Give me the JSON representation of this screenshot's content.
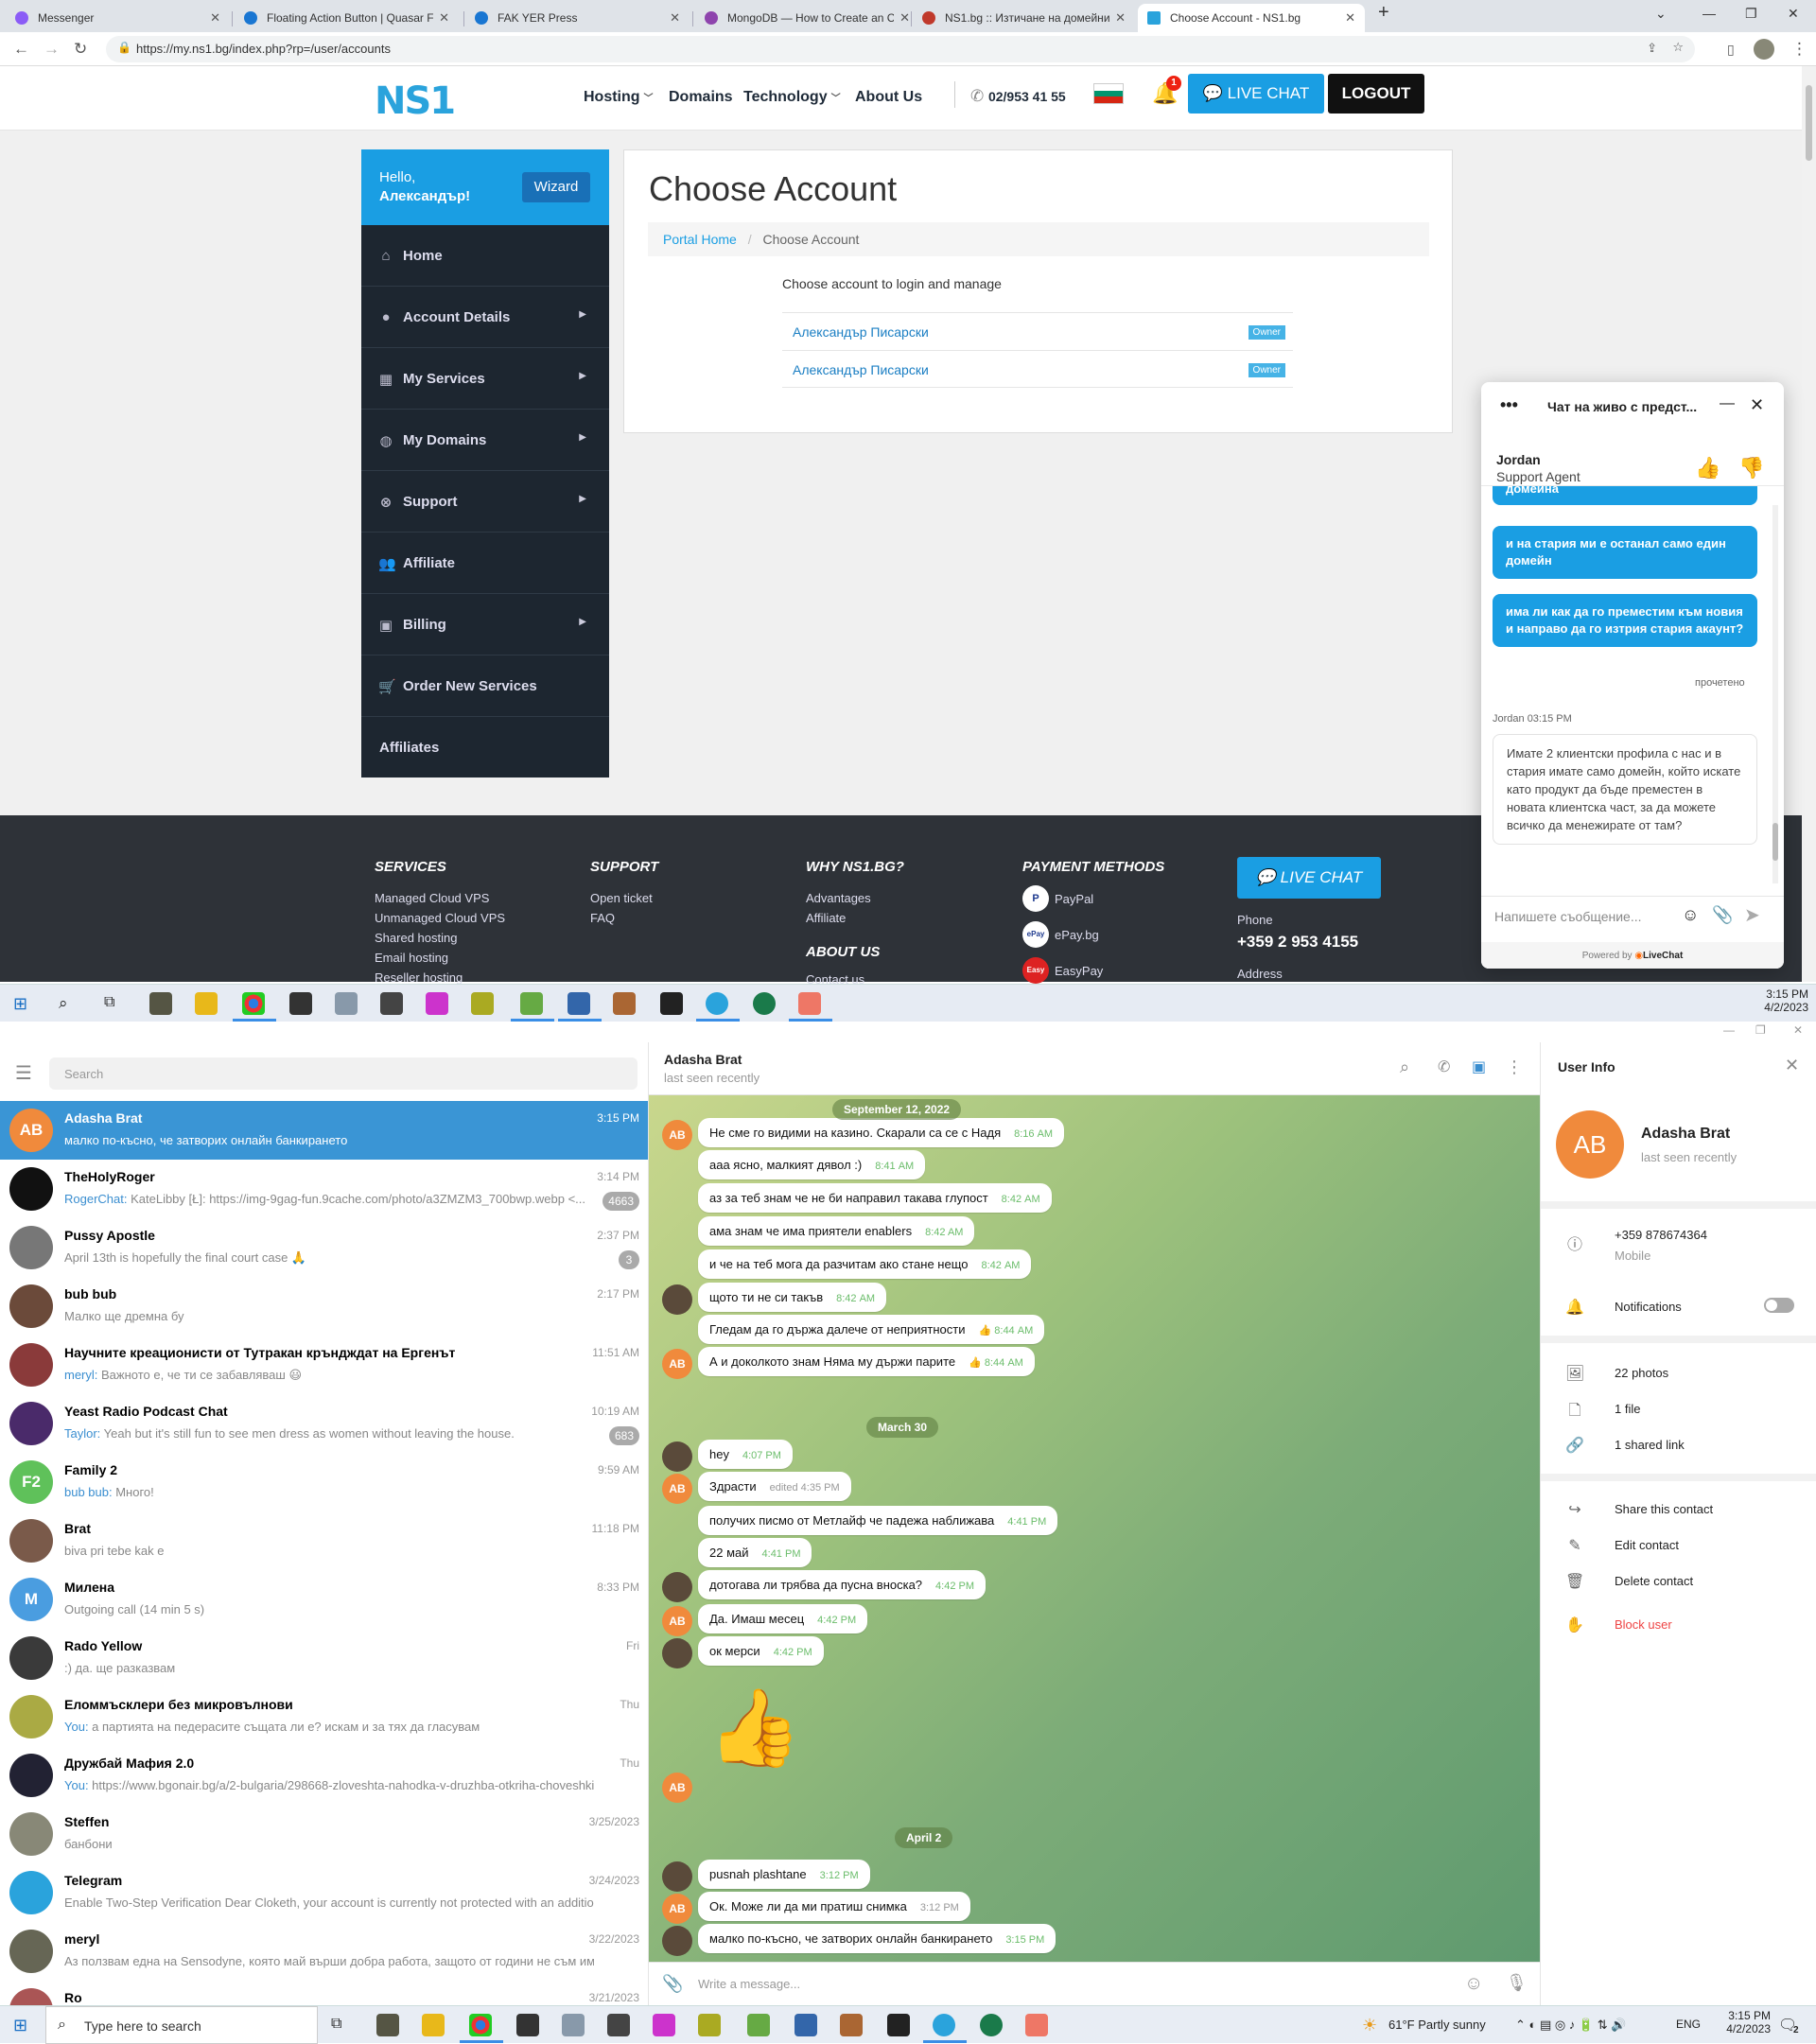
{
  "browser": {
    "tabs": [
      {
        "title": "Messenger",
        "color": "#8b5cf6"
      },
      {
        "title": "Floating Action Button | Quasar F",
        "color": "#1976d2"
      },
      {
        "title": "FAK YER Press",
        "color": "#1976d2"
      },
      {
        "title": "MongoDB — How to Create an C",
        "color": "#8e44ad"
      },
      {
        "title": "NS1.bg :: Изтичане на домейни",
        "color": "#c0392b"
      },
      {
        "title": "Choose Account - NS1.bg",
        "color": "#2aa3dc"
      }
    ],
    "url": "https://my.ns1.bg/index.php?rp=/user/accounts"
  },
  "ns1": {
    "logo": "NS1",
    "nav": {
      "hosting": "Hosting",
      "domains": "Domains",
      "technology": "Technology",
      "about": "About Us"
    },
    "phone": "02/953 41 55",
    "notif_count": "1",
    "live_chat": "LIVE CHAT",
    "logout": "LOGOUT",
    "sidebar": {
      "hello": "Hello,",
      "user": "Александър!",
      "wizard": "Wizard",
      "items": [
        "Home",
        "Account Details",
        "My Services",
        "My Domains",
        "Support",
        "Affiliate",
        "Billing",
        "Order New Services",
        "Affiliates"
      ]
    },
    "main": {
      "title": "Choose Account",
      "crumb_home": "Portal Home",
      "crumb_current": "Choose Account",
      "intro": "Choose account to login and manage",
      "accounts": [
        {
          "name": "Александър Писарски",
          "role": "Owner"
        },
        {
          "name": "Александър Писарски",
          "role": "Owner"
        }
      ]
    },
    "footer": {
      "services_h": "SERVICES",
      "services": [
        "Managed Cloud VPS",
        "Unmanaged Cloud VPS",
        "Shared hosting",
        "Email hosting",
        "Reseller hosting"
      ],
      "support_h": "SUPPORT",
      "support": [
        "Open ticket",
        "FAQ"
      ],
      "why_h": "WHY NS1.BG?",
      "why": [
        "Advantages",
        "Affiliate"
      ],
      "about_h": "ABOUT US",
      "about": [
        "Contact us"
      ],
      "pay_h": "PAYMENT METHODS",
      "pay": [
        "PayPal",
        "ePay.bg",
        "EasyPay"
      ],
      "live_chat": "LIVE CHAT",
      "phone_label": "Phone",
      "phone": "+359 2 953 4155",
      "address_label": "Address"
    }
  },
  "livechat": {
    "title": "Чат на живо с предст...",
    "agent_name": "Jordan",
    "agent_role": "Support Agent",
    "partial_msg": "домейна",
    "messages": [
      "и на стария ми е останал само един домейн",
      "има ли как да го преместим към новия и направо да го изтрия стария акаунт?"
    ],
    "read": "прочетено",
    "agent_meta": "Jordan 03:15 PM",
    "agent_msg": "Имате 2 клиентски профила с нас и в стария имате само домейн, който искате като продукт да бъде преместен в новата клиентска част, за да можете всичко да менежирате от там?",
    "placeholder": "Напишете съобщение...",
    "powered": "Powered by",
    "brand": "LiveChat"
  },
  "taskbar_top": {
    "time": "3:15 PM",
    "date": "4/2/2023"
  },
  "telegram": {
    "search": "Search",
    "chats": [
      {
        "name": "Adasha Brat",
        "preview": "малко по-късно, че затворих онлайн банкирането",
        "time": "3:15 PM",
        "initials": "AB",
        "color": "#f08a3c"
      },
      {
        "name": "TheHolyRoger",
        "who": "RogerChat:",
        "preview": " KateLibby [Ł]: https://img-9gag-fun.9cache.com/photo/a3ZMZM3_700bwp.webp <...",
        "time": "3:14 PM",
        "badge": "4663",
        "color": "#111"
      },
      {
        "name": "Pussy Apostle",
        "preview": "April 13th is hopefully the final court case 🙏",
        "time": "2:37 PM",
        "badge": "3",
        "color": "#777"
      },
      {
        "name": "bub bub",
        "preview": "Малко ще дремна бу",
        "time": "2:17 PM",
        "color": "#6b4a3a"
      },
      {
        "name": "Научните креационисти от Тутракан кръндждат на Ергенът",
        "who": "meryl:",
        "preview": " Важното е, че ти се забавляваш 😃",
        "time": "11:51 AM",
        "color": "#8a3a3a"
      },
      {
        "name": "Yeast Radio Podcast Chat",
        "who": "Taylor:",
        "preview": " Yeah but it's still fun to see men dress as women without leaving the house.",
        "time": "10:19 AM",
        "badge": "683",
        "color": "#4a2a6a"
      },
      {
        "name": "Family 2",
        "who": "bub bub:",
        "preview": " Много!",
        "time": "9:59 AM",
        "initials": "F2",
        "color": "#5fc15a"
      },
      {
        "name": "Brat",
        "preview": "biva pri tebe kak e",
        "time": "11:18 PM",
        "color": "#7a5a4a"
      },
      {
        "name": "Милена",
        "preview": "Outgoing call (14 min 5 s)",
        "time": "8:33 PM",
        "initials": "M",
        "color": "#4a9de0"
      },
      {
        "name": "Rado Yellow",
        "preview": ":) да. ще разказвам",
        "time": "Fri",
        "color": "#3a3a3a"
      },
      {
        "name": "Еломмъсклери без микровълнови",
        "who": "You:",
        "preview": " а партията на педерасите същата ли е? искам и за тях да гласувам",
        "time": "Thu",
        "color": "#aa4"
      },
      {
        "name": "Дружбай Мафия 2.0",
        "who": "You:",
        "preview": " https://www.bgonair.bg/a/2-bulgaria/298668-zloveshta-nahodka-v-druzhba-otkriha-choveshki-k...",
        "time": "Thu",
        "color": "#223"
      },
      {
        "name": "Steffen",
        "preview": "банбони",
        "time": "3/25/2023",
        "color": "#887"
      },
      {
        "name": "Telegram",
        "preview": "Enable Two-Step Verification Dear Cloketh, your account is currently not protected with an additiona...",
        "time": "3/24/2023",
        "color": "#2aa3dc"
      },
      {
        "name": "meryl",
        "preview": "Аз ползвам една на Sensodyne, която май върши добра работа, защото от години не съм имал...",
        "time": "3/22/2023",
        "color": "#665"
      },
      {
        "name": "Ro",
        "preview": "",
        "time": "3/21/2023",
        "color": "#a55"
      }
    ],
    "chat": {
      "name": "Adasha Brat",
      "status": "last seen recently",
      "dates": [
        "September 12, 2022",
        "March 30",
        "April 2"
      ],
      "messages": [
        {
          "text": "Не сме го видими на казино. Скарали са се с Надя",
          "time": "8:16 AM"
        },
        {
          "text": "ааа ясно, малкият дявол :)",
          "time": "8:41 AM"
        },
        {
          "text": "аз за теб знам че не би направил такава глупост",
          "time": "8:42 AM"
        },
        {
          "text": "ама знам че има приятели enablers",
          "time": "8:42 AM"
        },
        {
          "text": "и че на теб мога да разчитам ако стане нещо",
          "time": "8:42 AM"
        },
        {
          "text": "щото ти не си такъв",
          "time": "8:42 AM"
        },
        {
          "text": "Гледам да го държа далече от неприятности",
          "time": "👍 8:44 AM"
        },
        {
          "text": "А и доколкото знам Няма му държи парите",
          "time": "👍 8:44 AM"
        },
        {
          "text": "hey",
          "time": "4:07 PM"
        },
        {
          "text": "Здрасти",
          "time": "edited 4:35 PM"
        },
        {
          "text": "получих писмо от Метлайф че падежа наближава",
          "time": "4:41 PM"
        },
        {
          "text": "22 май",
          "time": "4:41 PM"
        },
        {
          "text": "дотогава ли трябва да пусна вноска?",
          "time": "4:42 PM"
        },
        {
          "text": "Да. Имаш месец",
          "time": "4:42 PM"
        },
        {
          "text": "ок мерси",
          "time": "4:42 PM"
        },
        {
          "text": "pusnah plashtane",
          "time": "3:12 PM"
        },
        {
          "text": "Ок. Може ли да ми пратиш снимка",
          "time": "3:12 PM"
        },
        {
          "text": "малко по-късно, че затворих онлайн банкирането",
          "time": "3:15 PM"
        }
      ],
      "composer": "Write a message..."
    },
    "user_info": {
      "title": "User Info",
      "name": "Adasha Brat",
      "status": "last seen recently",
      "initials": "AB",
      "phone": "+359 878674364",
      "phone_label": "Mobile",
      "notifications": "Notifications",
      "photos": "22 photos",
      "files": "1 file",
      "links": "1 shared link",
      "share": "Share this contact",
      "edit": "Edit contact",
      "delete": "Delete contact",
      "block": "Block user"
    }
  },
  "taskbar_bottom": {
    "search": "Type here to search",
    "weather": "61°F  Partly sunny",
    "lang": "ENG",
    "time": "3:15 PM",
    "date": "4/2/2023",
    "notif": "2"
  }
}
